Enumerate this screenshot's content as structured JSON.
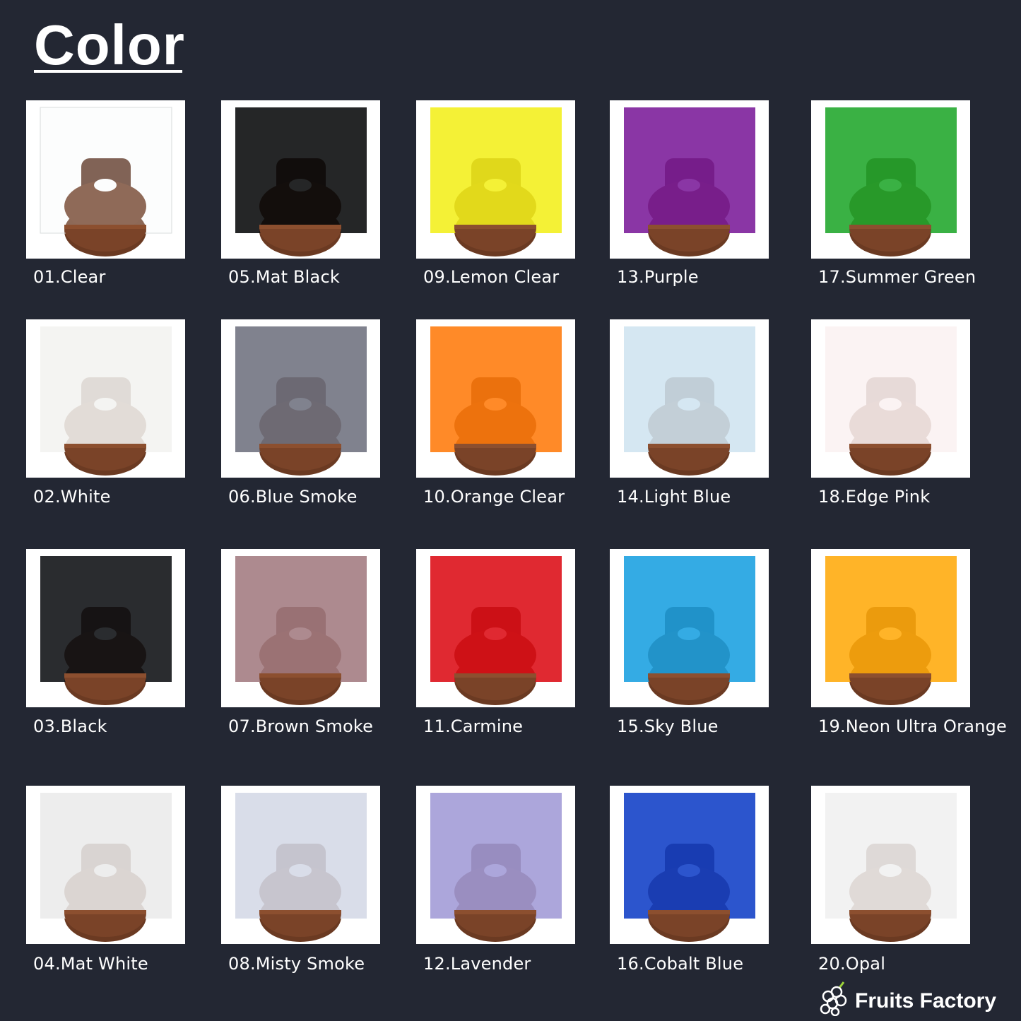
{
  "title": "Color",
  "swatches": [
    {
      "label": "01.Clear",
      "color": "#f4f6f6",
      "opacity": 0.25
    },
    {
      "label": "05.Mat Black",
      "color": "#070809",
      "opacity": 1
    },
    {
      "label": "09.Lemon Clear",
      "color": "#f3ef1a",
      "opacity": 1
    },
    {
      "label": "13.Purple",
      "color": "#7a1a99",
      "opacity": 1
    },
    {
      "label": "17.Summer Green",
      "color": "#1fa62a",
      "opacity": 1
    },
    {
      "label": "02.White",
      "color": "#f2f2f0",
      "opacity": 1
    },
    {
      "label": "06.Blue Smoke",
      "color": "#6e717e",
      "opacity": 1
    },
    {
      "label": "10.Orange Clear",
      "color": "#ff7a0a",
      "opacity": 1
    },
    {
      "label": "14.Light Blue",
      "color": "#cfe4f0",
      "opacity": 1
    },
    {
      "label": "18.Edge Pink",
      "color": "#faf1f1",
      "opacity": 1
    },
    {
      "label": "03.Black",
      "color": "#0c0f12",
      "opacity": 1
    },
    {
      "label": "07.Brown Smoke",
      "color": "#a27a80",
      "opacity": 1
    },
    {
      "label": "11.Carmine",
      "color": "#dc0b14",
      "opacity": 1
    },
    {
      "label": "15.Sky Blue",
      "color": "#189fe0",
      "opacity": 1
    },
    {
      "label": "19.Neon Ultra Orange",
      "color": "#ffaa0a",
      "opacity": 1
    },
    {
      "label": "04.Mat White",
      "color": "#eaeaea",
      "opacity": 1
    },
    {
      "label": "08.Misty Smoke",
      "color": "#d4d8e6",
      "opacity": 1
    },
    {
      "label": "12.Lavender",
      "color": "#a19ad6",
      "opacity": 1
    },
    {
      "label": "16.Cobalt Blue",
      "color": "#0f3dc6",
      "opacity": 1
    },
    {
      "label": "20.Opal",
      "color": "#f0f0f0",
      "opacity": 1
    }
  ],
  "brand": {
    "name": "Fruits Factory",
    "icon": "grape-logo-icon"
  }
}
